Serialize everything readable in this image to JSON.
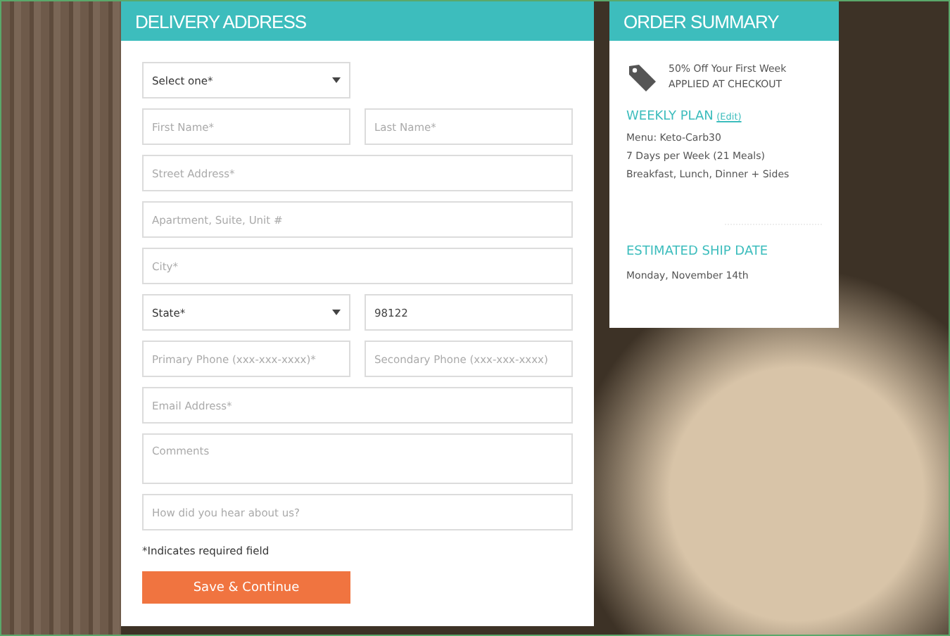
{
  "delivery": {
    "title": "DELIVERY ADDRESS",
    "rows": [
      [
        {
          "kind": "select",
          "value": "Select one*"
        }
      ],
      [
        {
          "kind": "input",
          "placeholder": "First Name*"
        },
        {
          "kind": "input",
          "placeholder": "Last Name*"
        }
      ],
      [
        {
          "kind": "input",
          "placeholder": "Street Address*"
        }
      ],
      [
        {
          "kind": "input",
          "placeholder": "Apartment, Suite, Unit #"
        }
      ],
      [
        {
          "kind": "input",
          "placeholder": "City*"
        }
      ],
      [
        {
          "kind": "select",
          "value": "State*"
        },
        {
          "kind": "input",
          "value": "98122"
        }
      ],
      [
        {
          "kind": "input",
          "placeholder": "Primary Phone (xxx-xxx-xxxx)*"
        },
        {
          "kind": "input",
          "placeholder": "Secondary Phone (xxx-xxx-xxxx)"
        }
      ],
      [
        {
          "kind": "input",
          "placeholder": "Email Address*"
        }
      ],
      [
        {
          "kind": "textarea",
          "placeholder": "Comments"
        }
      ],
      [
        {
          "kind": "input",
          "placeholder": "How did you hear about us?"
        }
      ]
    ],
    "note": "*Indicates required field",
    "button": "Save & Continue"
  },
  "summary": {
    "title": "ORDER SUMMARY",
    "promo": [
      "50% Off Your First Week",
      "APPLIED AT CHECKOUT"
    ],
    "plan_heading": "WEEKLY PLAN",
    "plan_edit": "(Edit)",
    "plan_lines": [
      "Menu: Keto-Carb30",
      "7 Days per Week (21 Meals)",
      "Breakfast, Lunch, Dinner + Sides"
    ],
    "ship_heading": "ESTIMATED SHIP DATE",
    "ship_date": "Monday, November 14th"
  }
}
